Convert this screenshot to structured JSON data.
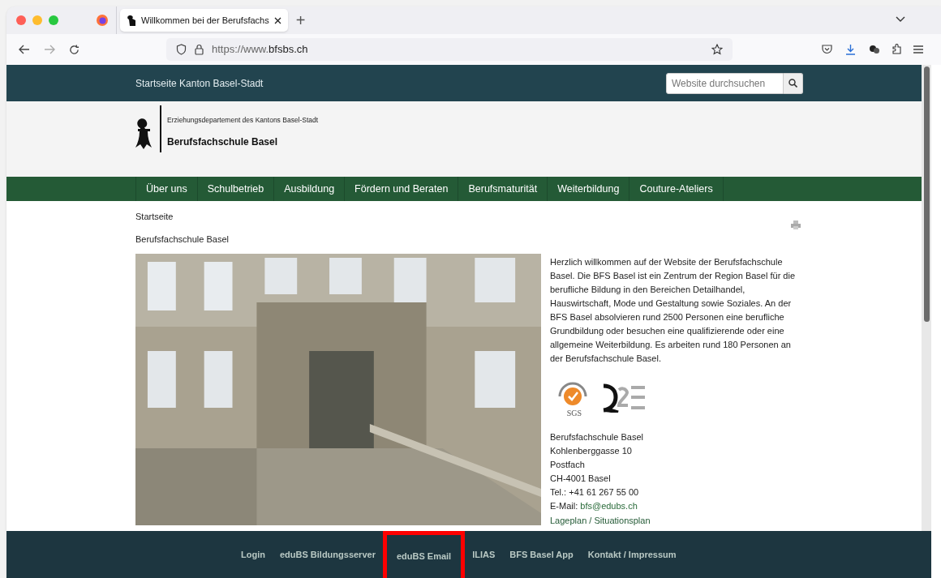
{
  "browser": {
    "tabs": [
      {
        "title": "Willkommen bei der Berufsfachs",
        "selected": true
      }
    ],
    "new_tab": "+",
    "url_prefix": "https://www.",
    "url_domain": "bfsbs.ch"
  },
  "top_bar": {
    "link": "Startseite Kanton Basel-Stadt",
    "search": {
      "placeholder": "Website durchsuchen"
    }
  },
  "header": {
    "department": "Erziehungsdepartement des Kantons Basel-Stadt",
    "school": "Berufsfachschule Basel"
  },
  "nav": [
    {
      "label": "Über uns"
    },
    {
      "label": "Schulbetrieb"
    },
    {
      "label": "Ausbildung"
    },
    {
      "label": "Fördern und Beraten"
    },
    {
      "label": "Berufsmaturität"
    },
    {
      "label": "Weiterbildung"
    },
    {
      "label": "Couture-Ateliers"
    }
  ],
  "breadcrumb": "Startseite",
  "page_title": "Berufsfachschule Basel",
  "intro": "Herzlich willkommen auf der Website der Berufsfachschule Basel. Die BFS Basel ist ein Zentrum der Region Basel für die berufliche Bildung in den Bereichen Detailhandel, Hauswirtschaft, Mode und Gestaltung sowie Soziales. An der BFS Basel absolvieren rund 2500 Personen eine berufliche Grundbildung oder besuchen eine qualifizierende oder eine allgemeine Weiterbildung. Es arbeiten rund 180 Personen an der Berufsfachschule Basel.",
  "certificates": {
    "sgs_label": "SGS"
  },
  "address": [
    "Berufsfachschule Basel",
    "Kohlenberggasse 10",
    "Postfach",
    "CH-4001 Basel",
    "Tel.: +41 61 267 55 00"
  ],
  "email": {
    "label": "E-Mail:",
    "address": "bfs@edubs.ch"
  },
  "map_link": "Lageplan / Situationsplan",
  "footer": [
    {
      "label": "Login",
      "highlighted": false
    },
    {
      "label": "eduBS Bildungsserver",
      "highlighted": false
    },
    {
      "label": "eduBS Email",
      "highlighted": true
    },
    {
      "label": "ILIAS",
      "highlighted": false
    },
    {
      "label": "BFS Basel App",
      "highlighted": false
    },
    {
      "label": "Kontakt / Impressum",
      "highlighted": false
    }
  ]
}
